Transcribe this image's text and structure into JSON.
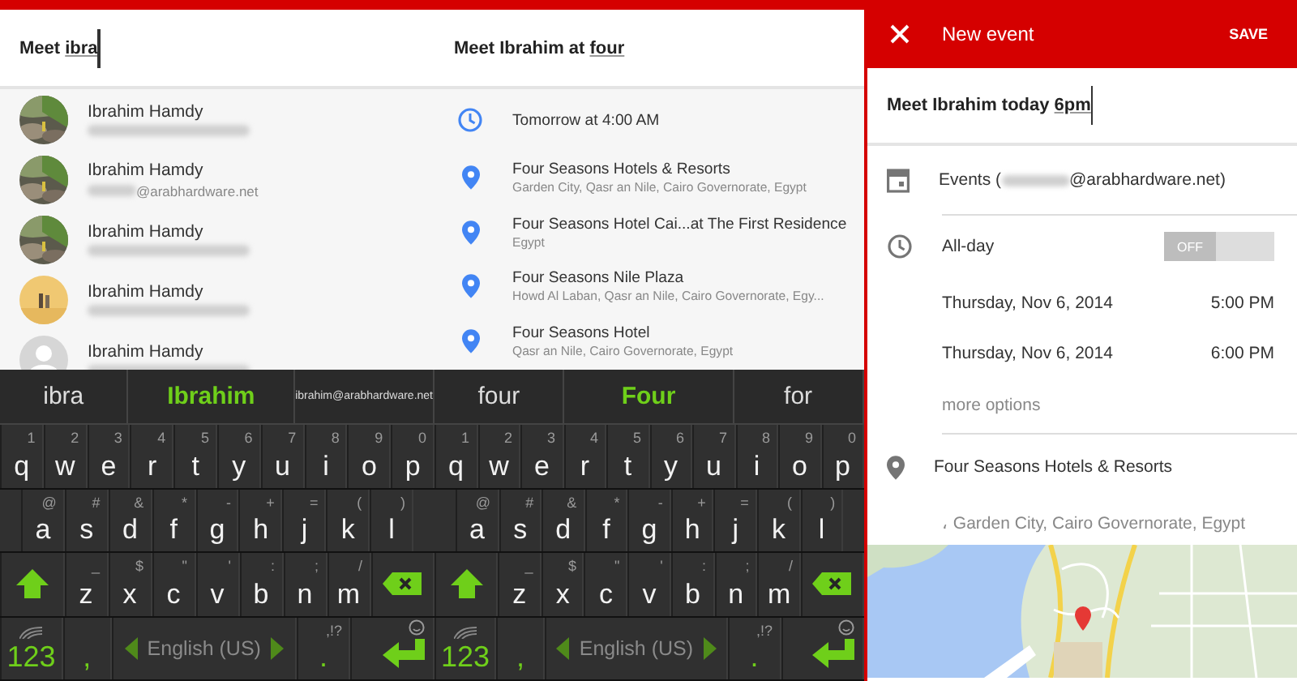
{
  "panels": [
    {
      "kind": "contacts",
      "field": {
        "text": "Meet ",
        "composing": "ibra",
        "cursor": true
      },
      "contacts": [
        {
          "name": "Ibrahim Hamdy"
        },
        {
          "name": "Ibrahim Hamdy",
          "email": "@arabhardware.net"
        },
        {
          "name": "Ibrahim Hamdy"
        },
        {
          "name": "Ibrahim Hamdy"
        },
        {
          "name": "Ibrahim Hamdy",
          "kind": "silhouette"
        }
      ],
      "keyboard": {
        "suggestions": [
          {
            "text": "ibra",
            "selected": false
          },
          {
            "text": "Ibrahim",
            "selected": true
          },
          {
            "text": "ibrahim@arabhardware.net",
            "selected": false
          }
        ],
        "rows": [
          {
            "keys": [
              {
                "kind": "char",
                "label": "q",
                "hint": "1"
              },
              {
                "kind": "char",
                "label": "w",
                "hint": "2"
              },
              {
                "kind": "char",
                "label": "e",
                "hint": "3"
              },
              {
                "kind": "char",
                "label": "r",
                "hint": "4"
              },
              {
                "kind": "char",
                "label": "t",
                "hint": "5"
              },
              {
                "kind": "char",
                "label": "y",
                "hint": "6"
              },
              {
                "kind": "char",
                "label": "u",
                "hint": "7"
              },
              {
                "kind": "char",
                "label": "i",
                "hint": "8"
              },
              {
                "kind": "char",
                "label": "o",
                "hint": "9"
              },
              {
                "kind": "char",
                "label": "p",
                "hint": "0"
              }
            ]
          },
          {
            "keys": [
              {
                "kind": "char",
                "label": "a",
                "hint": "@"
              },
              {
                "kind": "char",
                "label": "s",
                "hint": "#"
              },
              {
                "kind": "char",
                "label": "d",
                "hint": "&"
              },
              {
                "kind": "char",
                "label": "f",
                "hint": "*"
              },
              {
                "kind": "char",
                "label": "g",
                "hint": "-"
              },
              {
                "kind": "char",
                "label": "h",
                "hint": "+"
              },
              {
                "kind": "char",
                "label": "j",
                "hint": "="
              },
              {
                "kind": "char",
                "label": "k",
                "hint": "("
              },
              {
                "kind": "char",
                "label": "l",
                "hint": ")"
              }
            ]
          },
          {
            "keys": [
              {
                "kind": "shift"
              },
              {
                "kind": "char",
                "label": "z",
                "hint": "_"
              },
              {
                "kind": "char",
                "label": "x",
                "hint": "$"
              },
              {
                "kind": "char",
                "label": "c",
                "hint": "\""
              },
              {
                "kind": "char",
                "label": "v",
                "hint": "'"
              },
              {
                "kind": "char",
                "label": "b",
                "hint": ":"
              },
              {
                "kind": "char",
                "label": "n",
                "hint": ";"
              },
              {
                "kind": "char",
                "label": "m",
                "hint": "/"
              },
              {
                "kind": "backspace"
              }
            ]
          },
          {
            "keys": [
              {
                "kind": "mode",
                "label": "123"
              },
              {
                "kind": "punct",
                "label": ","
              },
              {
                "kind": "language",
                "label": "English (US)"
              },
              {
                "kind": "punct",
                "label": ".",
                "hint": ",!?"
              },
              {
                "kind": "enter"
              }
            ]
          }
        ]
      }
    },
    {
      "kind": "places",
      "field": {
        "text": "Meet Ibrahim at ",
        "composing": "four",
        "cursor": false
      },
      "results": [
        {
          "kind": "time",
          "title": "Tomorrow at 4:00 AM"
        },
        {
          "kind": "place",
          "title": "Four Seasons Hotels & Resorts",
          "subtitle": "Garden City, Qasr an Nile, Cairo Governorate, Egypt"
        },
        {
          "kind": "place",
          "title": "Four Seasons Hotel Cai...at The First Residence",
          "subtitle": "Egypt"
        },
        {
          "kind": "place",
          "title": "Four Seasons Nile Plaza",
          "subtitle": "Howd Al Laban, Qasr an Nile, Cairo Governorate, Egy..."
        },
        {
          "kind": "place",
          "title": "Four Seasons Hotel",
          "subtitle": "Qasr an Nile, Cairo Governorate, Egypt"
        }
      ],
      "keyboard": {
        "suggestions": [
          {
            "text": "four",
            "selected": false
          },
          {
            "text": "Four",
            "selected": true
          },
          {
            "text": "for",
            "selected": false
          }
        ],
        "rows": [
          {
            "keys": [
              {
                "kind": "char",
                "label": "q",
                "hint": "1"
              },
              {
                "kind": "char",
                "label": "w",
                "hint": "2"
              },
              {
                "kind": "char",
                "label": "e",
                "hint": "3"
              },
              {
                "kind": "char",
                "label": "r",
                "hint": "4"
              },
              {
                "kind": "char",
                "label": "t",
                "hint": "5"
              },
              {
                "kind": "char",
                "label": "y",
                "hint": "6"
              },
              {
                "kind": "char",
                "label": "u",
                "hint": "7"
              },
              {
                "kind": "char",
                "label": "i",
                "hint": "8"
              },
              {
                "kind": "char",
                "label": "o",
                "hint": "9"
              },
              {
                "kind": "char",
                "label": "p",
                "hint": "0"
              }
            ]
          },
          {
            "keys": [
              {
                "kind": "char",
                "label": "a",
                "hint": "@"
              },
              {
                "kind": "char",
                "label": "s",
                "hint": "#"
              },
              {
                "kind": "char",
                "label": "d",
                "hint": "&"
              },
              {
                "kind": "char",
                "label": "f",
                "hint": "*"
              },
              {
                "kind": "char",
                "label": "g",
                "hint": "-"
              },
              {
                "kind": "char",
                "label": "h",
                "hint": "+"
              },
              {
                "kind": "char",
                "label": "j",
                "hint": "="
              },
              {
                "kind": "char",
                "label": "k",
                "hint": "("
              },
              {
                "kind": "char",
                "label": "l",
                "hint": ")"
              }
            ]
          },
          {
            "keys": [
              {
                "kind": "shift"
              },
              {
                "kind": "char",
                "label": "z",
                "hint": "_"
              },
              {
                "kind": "char",
                "label": "x",
                "hint": "$"
              },
              {
                "kind": "char",
                "label": "c",
                "hint": "\""
              },
              {
                "kind": "char",
                "label": "v",
                "hint": "'"
              },
              {
                "kind": "char",
                "label": "b",
                "hint": ":"
              },
              {
                "kind": "char",
                "label": "n",
                "hint": ";"
              },
              {
                "kind": "char",
                "label": "m",
                "hint": "/"
              },
              {
                "kind": "backspace"
              }
            ]
          },
          {
            "keys": [
              {
                "kind": "mode",
                "label": "123"
              },
              {
                "kind": "punct",
                "label": ","
              },
              {
                "kind": "language",
                "label": "English (US)"
              },
              {
                "kind": "punct",
                "label": ".",
                "hint": ",!?"
              },
              {
                "kind": "enter"
              }
            ]
          }
        ]
      }
    },
    {
      "kind": "event",
      "header": {
        "title": "New event",
        "action": "SAVE"
      },
      "field": {
        "text": "Meet Ibrahim today ",
        "composing": "6pm",
        "cursor": true
      },
      "calendar": {
        "prefix": "Events (",
        "suffix": "@arabhardware.net)"
      },
      "all_day": {
        "label": "All-day",
        "switch_label": "OFF",
        "on": false
      },
      "times": [
        {
          "date": "Thursday, Nov 6, 2014",
          "time": "5:00 PM"
        },
        {
          "date": "Thursday, Nov 6, 2014",
          "time": "6:00 PM"
        }
      ],
      "more": "more options",
      "location": {
        "name": "Four Seasons Hotels & Resorts",
        "address": "، Garden City, Cairo Governorate, Egypt"
      },
      "map": {
        "kind": "picture"
      }
    }
  ]
}
